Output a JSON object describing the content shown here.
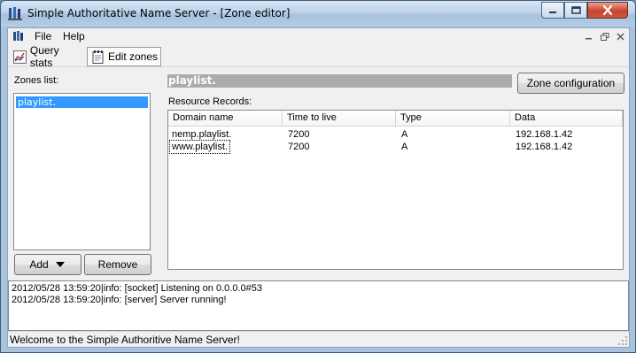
{
  "window": {
    "title": "Simple Authoritative Name Server - [Zone editor]"
  },
  "menu": {
    "file": "File",
    "help": "Help"
  },
  "toolbar": {
    "query_stats": "Query stats",
    "edit_zones": "Edit zones"
  },
  "zones": {
    "label": "Zones list:",
    "items": [
      "playlist."
    ],
    "add_label": "Add",
    "remove_label": "Remove"
  },
  "editor": {
    "zone_title": "playlist.",
    "zone_config_label": "Zone configuration",
    "rr_label": "Resource Records:",
    "columns": [
      "Domain name",
      "Time to live",
      "Type",
      "Data"
    ],
    "rows": [
      [
        "nemp.playlist.",
        "7200",
        "A",
        "192.168.1.42"
      ],
      [
        "www.playlist.",
        "7200",
        "A",
        "192.168.1.42"
      ]
    ]
  },
  "log": {
    "lines": [
      "2012/05/28 13:59:20|info: [socket] Listening on 0.0.0.0#53",
      "2012/05/28 13:59:20|info: [server] Server running!"
    ]
  },
  "status": {
    "text": "Welcome to the Simple Authoritive Name Server!"
  },
  "colors": {
    "selection": "#3399ff",
    "title_bar": "#bcd3ea",
    "zone_header_bg": "#ababab"
  }
}
